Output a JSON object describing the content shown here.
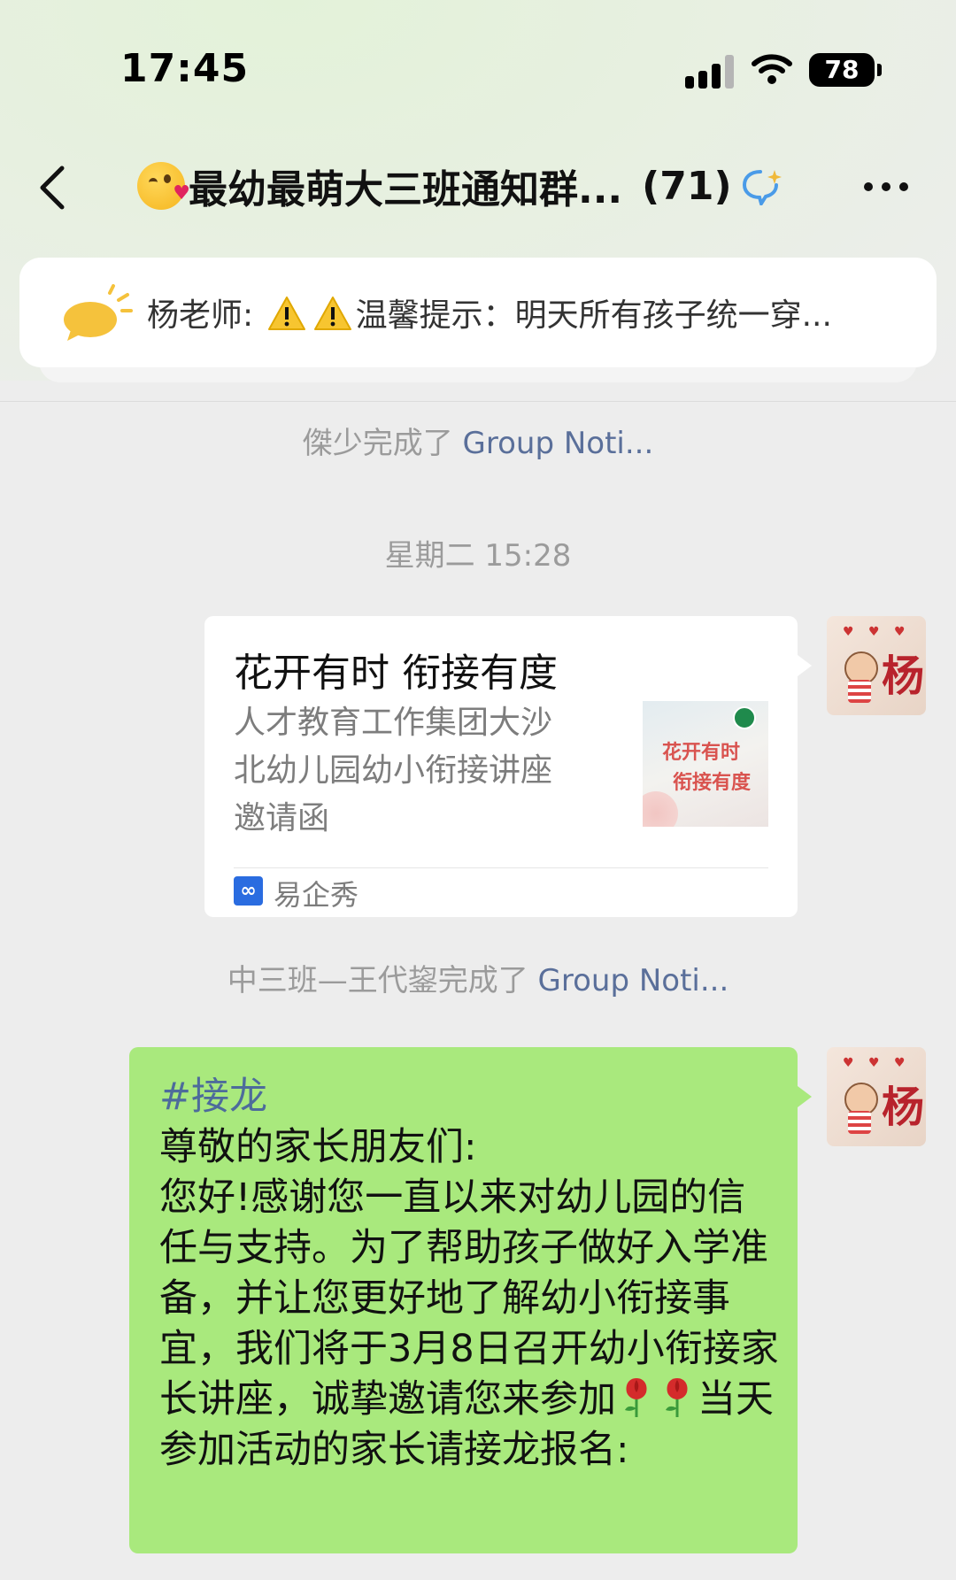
{
  "status_bar": {
    "time": "17:45",
    "battery": "78"
  },
  "nav": {
    "title": "最幼最萌大三班通知群...",
    "member_count": "(71)"
  },
  "pinned_notice": {
    "sender": "杨老师:",
    "text": "温馨提示：明天所有孩子统一穿..."
  },
  "messages": {
    "sys1": {
      "actor": "傑少完成了",
      "link": "Group Noti..."
    },
    "timestamp": "星期二 15:28",
    "card": {
      "title": "花开有时 衔接有度",
      "description": "人才教育工作集团大沙北幼儿园幼小衔接讲座邀请函",
      "thumb_line1": "花开有时",
      "thumb_line2": "衔接有度",
      "source_icon": "∞",
      "source": "易企秀"
    },
    "sys2": {
      "actor": "中三班—王代鋆完成了",
      "link": "Group Noti..."
    },
    "text_message": {
      "tag": "#接龙",
      "body_part1": "尊敬的家长朋友们:\n您好!感谢您一直以来对幼儿园的信任与支持。为了帮助孩子做好入学准备，并让您更好地了解幼小衔接事宜，我们将于3月8日召开幼小衔接家长讲座，诚挚邀请您来参加",
      "body_part2": "当天参加活动的家长请接龙报名:"
    }
  },
  "avatar": {
    "char": "杨",
    "hearts": "♥ ♥ ♥"
  },
  "colors": {
    "bubble_green": "#a9e97d",
    "link_blue": "#5a6f9a",
    "background": "#ededed"
  },
  "icons": [
    "back-chevron-icon",
    "kissing-face-emoji-icon",
    "chat-ai-icon",
    "more-dots-icon",
    "notice-bubble-icon",
    "warning-icon",
    "rose-icon",
    "yiqixiu-icon"
  ]
}
